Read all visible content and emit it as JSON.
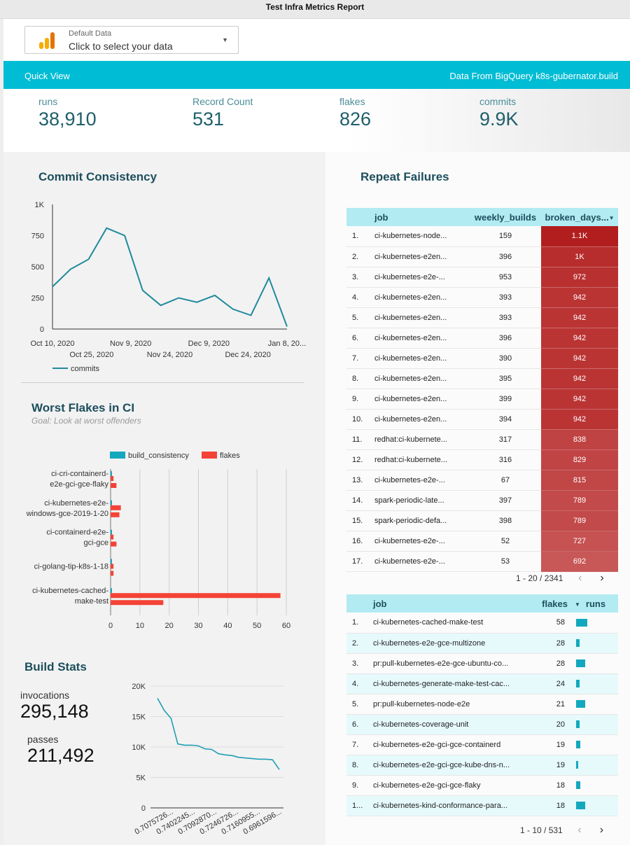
{
  "report": {
    "title": "Test Infra Metrics Report"
  },
  "datasource": {
    "label": "Default Data",
    "value": "Click to select your data",
    "icon": "analytics-icon"
  },
  "quickview": {
    "left": "Quick View",
    "right": "Data From BigQuery k8s-gubernator.build"
  },
  "kpis": [
    {
      "label": "runs",
      "value": "38,910"
    },
    {
      "label": "Record Count",
      "value": "531"
    },
    {
      "label": "flakes",
      "value": "826"
    },
    {
      "label": "commits",
      "value": "9.9K"
    }
  ],
  "commit_consistency": {
    "title": "Commit Consistency",
    "legend": "commits"
  },
  "worst_flakes": {
    "title": "Worst Flakes in CI",
    "goal": "Goal: Look at worst offenders"
  },
  "build_stats": {
    "title": "Build Stats",
    "invocations_label": "invocations",
    "invocations": "295,148",
    "passes_label": "passes",
    "passes": "211,492"
  },
  "repeat_failures": {
    "title": "Repeat Failures",
    "columns": [
      "job",
      "weekly_builds",
      "broken_days..."
    ],
    "sort_icon": "sort-desc-icon",
    "rows": [
      {
        "n": "1.",
        "job": "ci-kubernetes-node...",
        "weekly_builds": "159",
        "broken_days": "1.1K",
        "v": 1100
      },
      {
        "n": "2.",
        "job": "ci-kubernetes-e2en...",
        "weekly_builds": "396",
        "broken_days": "1K",
        "v": 1000
      },
      {
        "n": "3.",
        "job": "ci-kubernetes-e2e-...",
        "weekly_builds": "953",
        "broken_days": "972",
        "v": 972
      },
      {
        "n": "4.",
        "job": "ci-kubernetes-e2en...",
        "weekly_builds": "393",
        "broken_days": "942",
        "v": 942
      },
      {
        "n": "5.",
        "job": "ci-kubernetes-e2en...",
        "weekly_builds": "393",
        "broken_days": "942",
        "v": 942
      },
      {
        "n": "6.",
        "job": "ci-kubernetes-e2en...",
        "weekly_builds": "396",
        "broken_days": "942",
        "v": 942
      },
      {
        "n": "7.",
        "job": "ci-kubernetes-e2en...",
        "weekly_builds": "390",
        "broken_days": "942",
        "v": 942
      },
      {
        "n": "8.",
        "job": "ci-kubernetes-e2en...",
        "weekly_builds": "395",
        "broken_days": "942",
        "v": 942
      },
      {
        "n": "9.",
        "job": "ci-kubernetes-e2en...",
        "weekly_builds": "399",
        "broken_days": "942",
        "v": 942
      },
      {
        "n": "10.",
        "job": "ci-kubernetes-e2en...",
        "weekly_builds": "394",
        "broken_days": "942",
        "v": 942
      },
      {
        "n": "11.",
        "job": "redhat:ci-kubernete...",
        "weekly_builds": "317",
        "broken_days": "838",
        "v": 838
      },
      {
        "n": "12.",
        "job": "redhat:ci-kubernete...",
        "weekly_builds": "316",
        "broken_days": "829",
        "v": 829
      },
      {
        "n": "13.",
        "job": "ci-kubernetes-e2e-...",
        "weekly_builds": "67",
        "broken_days": "815",
        "v": 815
      },
      {
        "n": "14.",
        "job": "spark-periodic-late...",
        "weekly_builds": "397",
        "broken_days": "789",
        "v": 789
      },
      {
        "n": "15.",
        "job": "spark-periodic-defa...",
        "weekly_builds": "398",
        "broken_days": "789",
        "v": 789
      },
      {
        "n": "16.",
        "job": "ci-kubernetes-e2e-...",
        "weekly_builds": "52",
        "broken_days": "727",
        "v": 727
      },
      {
        "n": "17.",
        "job": "ci-kubernetes-e2e-...",
        "weekly_builds": "53",
        "broken_days": "692",
        "v": 692
      }
    ],
    "pager": "1 - 20 / 2341"
  },
  "flakes_table": {
    "columns": [
      "job",
      "flakes",
      "runs"
    ],
    "sort_icon": "sort-desc-icon",
    "rows": [
      {
        "n": "1.",
        "job": "ci-kubernetes-cached-make-test",
        "flakes": "58",
        "runs": 0.9
      },
      {
        "n": "2.",
        "job": "ci-kubernetes-e2e-gce-multizone",
        "flakes": "28",
        "runs": 0.25
      },
      {
        "n": "3.",
        "job": "pr:pull-kubernetes-e2e-gce-ubuntu-co...",
        "flakes": "28",
        "runs": 0.7
      },
      {
        "n": "4.",
        "job": "ci-kubernetes-generate-make-test-cac...",
        "flakes": "24",
        "runs": 0.25
      },
      {
        "n": "5.",
        "job": "pr:pull-kubernetes-node-e2e",
        "flakes": "21",
        "runs": 0.7
      },
      {
        "n": "6.",
        "job": "ci-kubernetes-coverage-unit",
        "flakes": "20",
        "runs": 0.25
      },
      {
        "n": "7.",
        "job": "ci-kubernetes-e2e-gci-gce-containerd",
        "flakes": "19",
        "runs": 0.35
      },
      {
        "n": "8.",
        "job": "ci-kubernetes-e2e-gci-gce-kube-dns-n...",
        "flakes": "19",
        "runs": 0.15
      },
      {
        "n": "9.",
        "job": "ci-kubernetes-e2e-gci-gce-flaky",
        "flakes": "18",
        "runs": 0.35
      },
      {
        "n": "1...",
        "job": "ci-kubernetes-kind-conformance-para...",
        "flakes": "18",
        "runs": 0.7
      }
    ],
    "pager": "1 - 10 / 531"
  },
  "chart_data": [
    {
      "type": "line",
      "title": "Commit Consistency",
      "x_tick_labels": [
        "Oct 10, 2020",
        "Oct 25, 2020",
        "Nov 9, 2020",
        "Nov 24, 2020",
        "Dec 9, 2020",
        "Dec 24, 2020",
        "Jan 8, 20..."
      ],
      "y_tick_labels": [
        "0",
        "250",
        "500",
        "750",
        "1K"
      ],
      "ylim": [
        0,
        1000
      ],
      "series": [
        {
          "name": "commits",
          "color": "#1f8a9c",
          "values": [
            340,
            480,
            560,
            810,
            750,
            310,
            190,
            250,
            215,
            270,
            160,
            110,
            410,
            20
          ]
        }
      ],
      "legend": "bottom-left"
    },
    {
      "type": "bar",
      "orientation": "horizontal",
      "title": "Worst Flakes in CI",
      "categories": [
        "ci-cri-containerd-e2e-gci-gce-flaky",
        "ci-kubernetes-e2e-windows-gce-2019-1-20",
        "ci-containerd-e2e-gci-gce",
        "ci-golang-tip-k8s-1-18",
        "ci-kubernetes-cached-make-test"
      ],
      "series": [
        {
          "name": "build_consistency",
          "color": "#12a8bd",
          "values": [
            0.3,
            0.3,
            0.3,
            0.3,
            0.3
          ]
        },
        {
          "name": "flakes",
          "color": "#f44336",
          "values": [
            1,
            3.5,
            1,
            1,
            58
          ]
        }
      ],
      "extra_flakes_bars": [
        2,
        3,
        2,
        1,
        18
      ],
      "x_ticks": [
        0,
        10,
        20,
        30,
        40,
        50,
        60
      ],
      "xlim": [
        0,
        60
      ],
      "legend": "top"
    },
    {
      "type": "line",
      "title": "Build Stats",
      "y_tick_labels": [
        "0",
        "5K",
        "10K",
        "15K",
        "20K"
      ],
      "ylim": [
        0,
        20000
      ],
      "x_tick_labels": [
        "0.7075726...",
        "0.7402245...",
        "0.7092870...",
        "0.7246726...",
        "0.7160955...",
        "0.6961596..."
      ],
      "series": [
        {
          "color": "#1f9fb3",
          "values": [
            18000,
            16000,
            14700,
            10500,
            10300,
            10300,
            10200,
            9700,
            9600,
            8900,
            8700,
            8600,
            8300,
            8200,
            8100,
            8000,
            8000,
            7900,
            6300
          ]
        }
      ]
    }
  ]
}
